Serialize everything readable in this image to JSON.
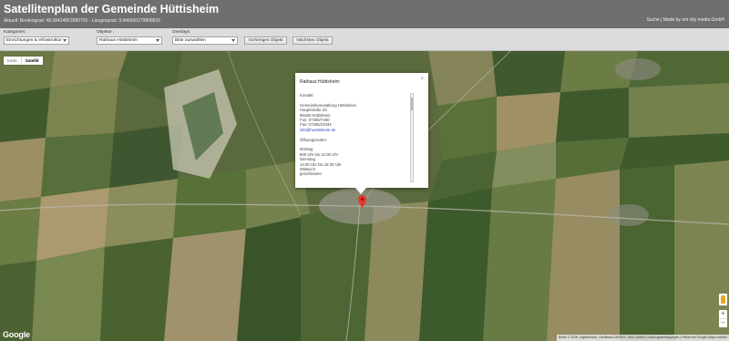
{
  "header": {
    "title": "Satellitenplan der Gemeinde Hüttisheim",
    "coords": "Aktuell: Breitengrad: 48.28424853580705 - Längengrad: 9.946660279808815",
    "links": [
      "Suche",
      "Made by om city media GmbH"
    ]
  },
  "filters": {
    "kategorien": {
      "label": "Kategorien:",
      "value": "Einrichtungen & Infrastruktur"
    },
    "objekte": {
      "label": "Objekte :",
      "value": "Rathaus Hüttisheim"
    },
    "overlays": {
      "label": "Overlays:",
      "value": "Bitte auswählen"
    },
    "prev_button": "Vorheriges Objekt",
    "next_button": "Nächstes Objekt"
  },
  "map": {
    "type_options": [
      "Karte",
      "Satellit"
    ],
    "active_type": "Satellit",
    "popup": {
      "title": "Rathaus Hüttisheim",
      "close": "×",
      "kontakt_heading": "Kontakt",
      "address_lines": [
        "Gemeindeverwaltung Hüttisheim",
        "Hauptstraße 33",
        "89185 Hüttisheim",
        "Fon: 07305/7280",
        "Fax: 07305/23334"
      ],
      "email": "info@huettisheim.de",
      "hours_heading": "Öffnungszeiten:",
      "hours_lines": [
        "Montag",
        "800 Uhr bis 12.00 Uhr",
        "Dienstag",
        "14.00 Uhr bis 18.30 Uhr",
        "Mittwoch",
        "geschlossen"
      ]
    },
    "zoom_in": "+",
    "zoom_out": "−",
    "logo": "Google",
    "attribution": "Bilder © 2018, DigitalGlobe, GeoBasis-DE/BKG, GeoContent | Nutzungsbedingungen | Fehler bei Google Maps melden"
  },
  "colors": {
    "header_bg": "#6f6f6f",
    "filter_bg": "#dcdcdc",
    "marker": "#e8342a"
  }
}
